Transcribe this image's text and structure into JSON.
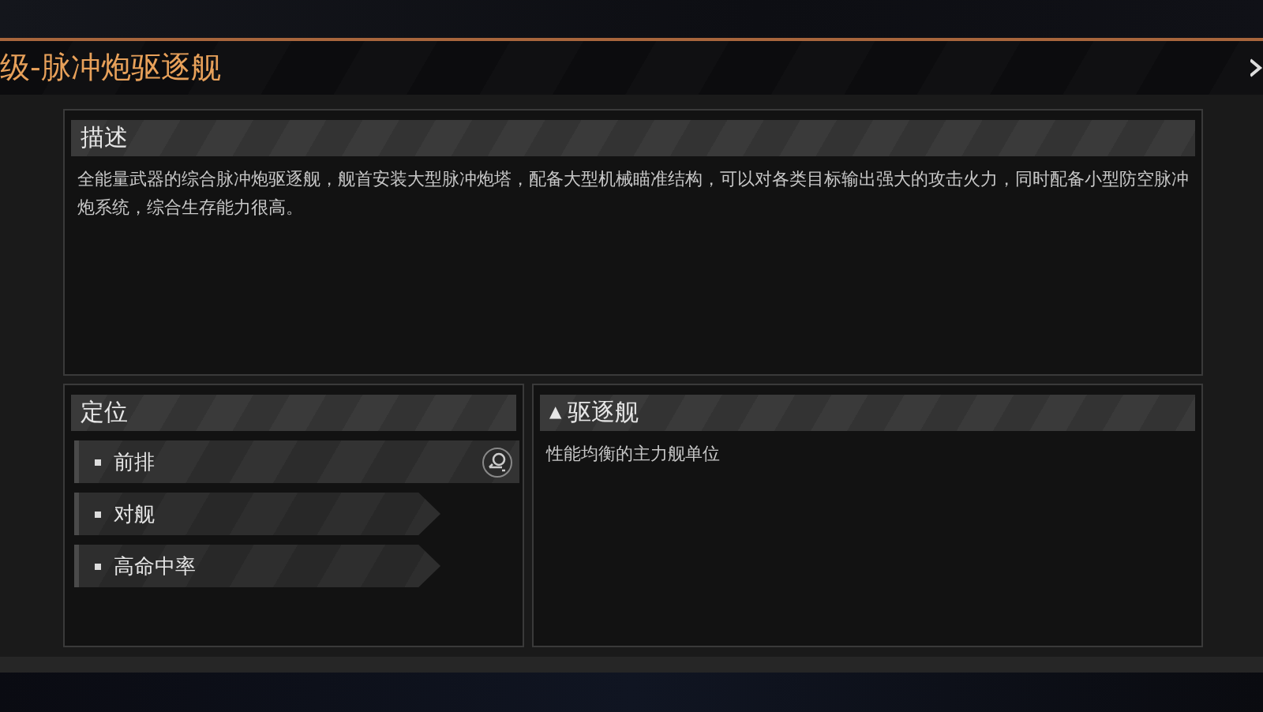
{
  "title": "级-脉冲炮驱逐舰",
  "description": {
    "heading": "描述",
    "text": "全能量武器的综合脉冲炮驱逐舰，舰首安装大型脉冲炮塔，配备大型机械瞄准结构，可以对各类目标输出强大的攻击火力，同时配备小型防空脉冲炮系统，综合生存能力很高。"
  },
  "positioning": {
    "heading": "定位",
    "items": [
      {
        "label": "前排",
        "selected": true
      },
      {
        "label": "对舰",
        "selected": false
      },
      {
        "label": "高命中率",
        "selected": false
      }
    ]
  },
  "ship_class": {
    "icon": "▲",
    "heading": "驱逐舰",
    "text": "性能均衡的主力舰单位"
  }
}
